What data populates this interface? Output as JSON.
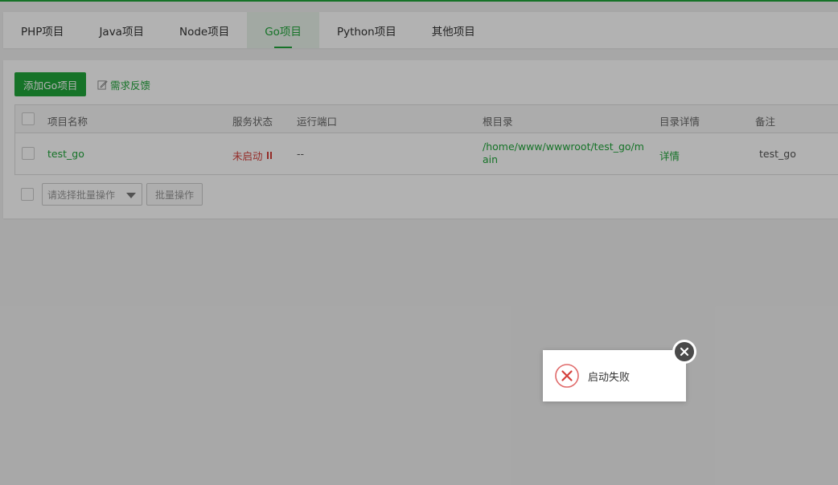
{
  "tabs": [
    {
      "label": "PHP项目",
      "active": false
    },
    {
      "label": "Java项目",
      "active": false
    },
    {
      "label": "Node项目",
      "active": false
    },
    {
      "label": "Go项目",
      "active": true
    },
    {
      "label": "Python项目",
      "active": false
    },
    {
      "label": "其他项目",
      "active": false
    }
  ],
  "toolbar": {
    "add_label": "添加Go项目",
    "feedback_label": "需求反馈"
  },
  "table": {
    "headers": {
      "name": "项目名称",
      "status": "服务状态",
      "port": "运行端口",
      "root": "根目录",
      "detail": "目录详情",
      "remark": "备注"
    },
    "rows": [
      {
        "name": "test_go",
        "status": "未启动",
        "port": "--",
        "root": "/home/www/wwwroot/test_go/main",
        "detail": "详情",
        "remark": "test_go"
      }
    ]
  },
  "batch": {
    "select_placeholder": "请选择批量操作",
    "button_label": "批量操作"
  },
  "toast": {
    "message": "启动失败"
  },
  "colors": {
    "accent": "#20a53a",
    "error": "#d43f3a"
  }
}
